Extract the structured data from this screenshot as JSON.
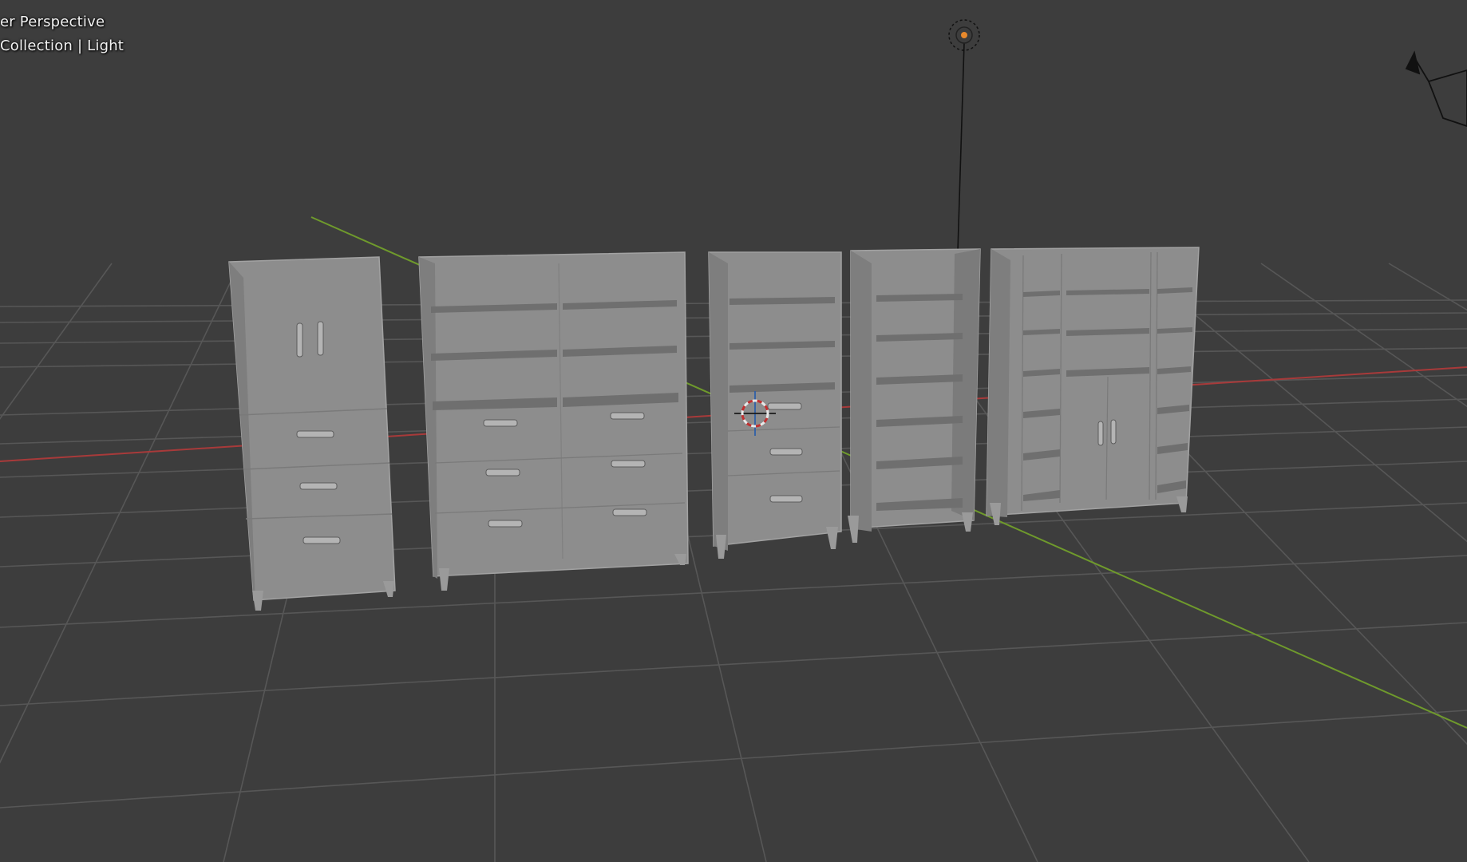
{
  "viewport": {
    "view_name": "er Perspective",
    "collection_info": "Collection | Light",
    "background_color": "#3d3d3d",
    "grid_color": "#585858",
    "axis_x_color": "#b33a3a",
    "axis_y_color": "#6f9e2a",
    "object_color": "#8f8f8f"
  },
  "icons": {
    "light": "light-icon",
    "camera": "camera-icon",
    "cursor": "3d-cursor-icon"
  }
}
